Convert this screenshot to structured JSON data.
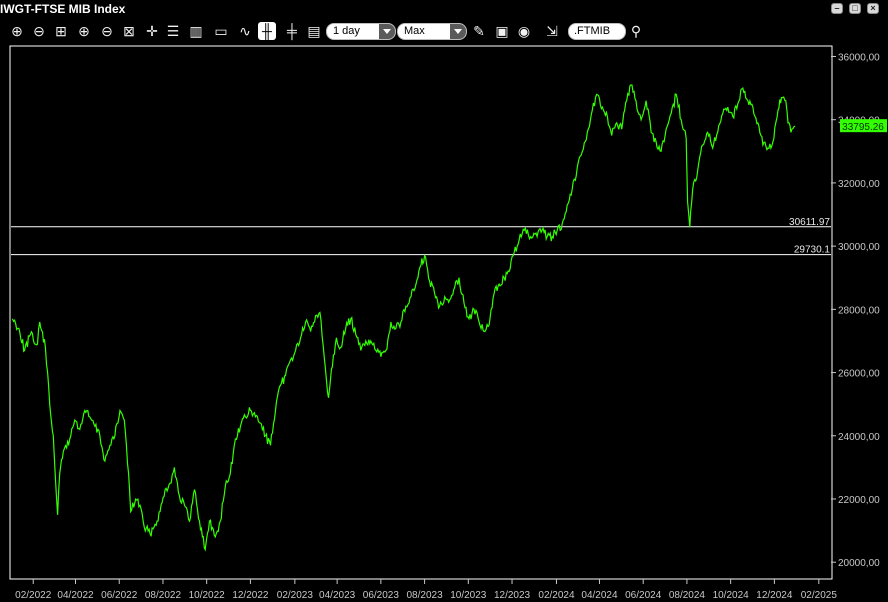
{
  "window": {
    "title": "IWGT-FTSE MIB Index"
  },
  "toolbar": {
    "interval_value": "1 day",
    "range_value": "Max",
    "symbol_value": ".FTMIB",
    "icons": [
      "zoom-in-icon",
      "zoom-out-icon",
      "zoom-fit-icon",
      "zoom-x-in-icon",
      "zoom-x-out-icon",
      "zoom-reset-icon",
      "crosshair-icon",
      "list-icon",
      "bars-icon",
      "box-icon",
      "line-chart-icon",
      "candlestick-icon",
      "ohlc-icon",
      "table-icon",
      "drawing-icon",
      "save-icon",
      "refresh-icon",
      "export-icon",
      "search-icon"
    ]
  },
  "colors": {
    "background": "#000000",
    "price_line": "#33ff00",
    "axis_text": "#c8c8c8",
    "horizontal_line": "#ffffff"
  },
  "chart_data": {
    "type": "line",
    "title": "IWGT-FTSE MIB Index",
    "grid": false,
    "ylim": [
      19500,
      36300
    ],
    "y_ticks": [
      "20000,00",
      "22000,00",
      "24000,00",
      "26000,00",
      "28000,00",
      "30000,00",
      "32000,00",
      "34000,00",
      "36000,00"
    ],
    "x_ticks": [
      "02/2022",
      "04/2022",
      "06/2022",
      "08/2022",
      "10/2022",
      "12/2022",
      "02/2023",
      "04/2023",
      "06/2023",
      "08/2023",
      "10/2023",
      "12/2023",
      "02/2024",
      "04/2024",
      "06/2024",
      "08/2024",
      "10/2024",
      "12/2024",
      "02/2025"
    ],
    "series": [
      {
        "points": [
          [
            "2022-01-03",
            27700
          ],
          [
            "2022-01-12",
            27400
          ],
          [
            "2022-01-20",
            26700
          ],
          [
            "2022-01-28",
            27200
          ],
          [
            "2022-02-07",
            26900
          ],
          [
            "2022-02-10",
            27600
          ],
          [
            "2022-02-18",
            26800
          ],
          [
            "2022-02-24",
            25000
          ],
          [
            "2022-03-01",
            24000
          ],
          [
            "2022-03-07",
            21500
          ],
          [
            "2022-03-10",
            22800
          ],
          [
            "2022-03-15",
            23500
          ],
          [
            "2022-03-24",
            23900
          ],
          [
            "2022-03-31",
            24500
          ],
          [
            "2022-04-07",
            24200
          ],
          [
            "2022-04-14",
            24800
          ],
          [
            "2022-04-21",
            24600
          ],
          [
            "2022-04-28",
            24300
          ],
          [
            "2022-05-05",
            24000
          ],
          [
            "2022-05-12",
            23200
          ],
          [
            "2022-05-19",
            23700
          ],
          [
            "2022-05-26",
            24000
          ],
          [
            "2022-06-02",
            24800
          ],
          [
            "2022-06-08",
            24500
          ],
          [
            "2022-06-14",
            22800
          ],
          [
            "2022-06-17",
            21600
          ],
          [
            "2022-06-24",
            22000
          ],
          [
            "2022-06-30",
            21800
          ],
          [
            "2022-07-06",
            21100
          ],
          [
            "2022-07-14",
            20900
          ],
          [
            "2022-07-21",
            21200
          ],
          [
            "2022-07-28",
            21600
          ],
          [
            "2022-08-04",
            22300
          ],
          [
            "2022-08-11",
            22500
          ],
          [
            "2022-08-17",
            23000
          ],
          [
            "2022-08-24",
            22100
          ],
          [
            "2022-08-31",
            21800
          ],
          [
            "2022-09-07",
            21300
          ],
          [
            "2022-09-14",
            22300
          ],
          [
            "2022-09-21",
            21300
          ],
          [
            "2022-09-29",
            20400
          ],
          [
            "2022-10-05",
            21300
          ],
          [
            "2022-10-13",
            20800
          ],
          [
            "2022-10-20",
            21300
          ],
          [
            "2022-10-27",
            22400
          ],
          [
            "2022-11-03",
            22800
          ],
          [
            "2022-11-10",
            23900
          ],
          [
            "2022-11-17",
            24300
          ],
          [
            "2022-11-24",
            24600
          ],
          [
            "2022-12-01",
            24800
          ],
          [
            "2022-12-08",
            24600
          ],
          [
            "2022-12-15",
            24400
          ],
          [
            "2022-12-22",
            24000
          ],
          [
            "2022-12-29",
            23700
          ],
          [
            "2023-01-05",
            24800
          ],
          [
            "2023-01-12",
            25600
          ],
          [
            "2023-01-19",
            25900
          ],
          [
            "2023-01-26",
            26400
          ],
          [
            "2023-02-02",
            26700
          ],
          [
            "2023-02-09",
            27100
          ],
          [
            "2023-02-16",
            27600
          ],
          [
            "2023-02-23",
            27300
          ],
          [
            "2023-03-02",
            27800
          ],
          [
            "2023-03-08",
            27900
          ],
          [
            "2023-03-14",
            26500
          ],
          [
            "2023-03-20",
            25200
          ],
          [
            "2023-03-24",
            26100
          ],
          [
            "2023-03-31",
            27100
          ],
          [
            "2023-04-06",
            26800
          ],
          [
            "2023-04-13",
            27400
          ],
          [
            "2023-04-20",
            27700
          ],
          [
            "2023-04-27",
            27200
          ],
          [
            "2023-05-04",
            26700
          ],
          [
            "2023-05-11",
            27000
          ],
          [
            "2023-05-18",
            27000
          ],
          [
            "2023-05-25",
            26700
          ],
          [
            "2023-06-01",
            26500
          ],
          [
            "2023-06-08",
            26700
          ],
          [
            "2023-06-15",
            27600
          ],
          [
            "2023-06-22",
            27400
          ],
          [
            "2023-06-29",
            27600
          ],
          [
            "2023-07-06",
            28100
          ],
          [
            "2023-07-13",
            28400
          ],
          [
            "2023-07-20",
            28800
          ],
          [
            "2023-07-27",
            29400
          ],
          [
            "2023-08-01",
            29700
          ],
          [
            "2023-08-08",
            28900
          ],
          [
            "2023-08-15",
            28500
          ],
          [
            "2023-08-22",
            28100
          ],
          [
            "2023-08-29",
            28400
          ],
          [
            "2023-09-05",
            28300
          ],
          [
            "2023-09-12",
            28700
          ],
          [
            "2023-09-18",
            29000
          ],
          [
            "2023-09-25",
            28200
          ],
          [
            "2023-10-02",
            27700
          ],
          [
            "2023-10-09",
            28000
          ],
          [
            "2023-10-16",
            27600
          ],
          [
            "2023-10-23",
            27300
          ],
          [
            "2023-10-30",
            27500
          ],
          [
            "2023-11-06",
            28500
          ],
          [
            "2023-11-13",
            28800
          ],
          [
            "2023-11-20",
            29000
          ],
          [
            "2023-11-27",
            29200
          ],
          [
            "2023-12-04",
            29800
          ],
          [
            "2023-12-11",
            30200
          ],
          [
            "2023-12-18",
            30500
          ],
          [
            "2023-12-27",
            30300
          ],
          [
            "2024-01-05",
            30300
          ],
          [
            "2024-01-12",
            30500
          ],
          [
            "2024-01-19",
            30300
          ],
          [
            "2024-01-26",
            30300
          ],
          [
            "2024-02-02",
            30500
          ],
          [
            "2024-02-09",
            30700
          ],
          [
            "2024-02-16",
            31300
          ],
          [
            "2024-02-23",
            31800
          ],
          [
            "2024-03-01",
            32500
          ],
          [
            "2024-03-08",
            33000
          ],
          [
            "2024-03-15",
            33600
          ],
          [
            "2024-03-22",
            34300
          ],
          [
            "2024-03-28",
            34800
          ],
          [
            "2024-04-05",
            34400
          ],
          [
            "2024-04-12",
            34100
          ],
          [
            "2024-04-18",
            33500
          ],
          [
            "2024-04-25",
            33900
          ],
          [
            "2024-05-02",
            33700
          ],
          [
            "2024-05-09",
            34600
          ],
          [
            "2024-05-15",
            35100
          ],
          [
            "2024-05-22",
            34600
          ],
          [
            "2024-05-29",
            34000
          ],
          [
            "2024-06-05",
            34600
          ],
          [
            "2024-06-12",
            33600
          ],
          [
            "2024-06-19",
            33300
          ],
          [
            "2024-06-26",
            33000
          ],
          [
            "2024-07-03",
            33700
          ],
          [
            "2024-07-10",
            34200
          ],
          [
            "2024-07-17",
            34800
          ],
          [
            "2024-07-24",
            34000
          ],
          [
            "2024-07-31",
            33400
          ],
          [
            "2024-08-02",
            31400
          ],
          [
            "2024-08-05",
            30600
          ],
          [
            "2024-08-09",
            31800
          ],
          [
            "2024-08-16",
            32400
          ],
          [
            "2024-08-23",
            33200
          ],
          [
            "2024-08-30",
            33600
          ],
          [
            "2024-09-06",
            33100
          ],
          [
            "2024-09-13",
            33600
          ],
          [
            "2024-09-20",
            34200
          ],
          [
            "2024-09-27",
            34400
          ],
          [
            "2024-10-04",
            34100
          ],
          [
            "2024-10-11",
            34500
          ],
          [
            "2024-10-18",
            35000
          ],
          [
            "2024-10-25",
            34600
          ],
          [
            "2024-11-01",
            34400
          ],
          [
            "2024-11-08",
            33900
          ],
          [
            "2024-11-15",
            33200
          ],
          [
            "2024-11-22",
            33100
          ],
          [
            "2024-11-29",
            33300
          ],
          [
            "2024-12-06",
            34300
          ],
          [
            "2024-12-11",
            34700
          ],
          [
            "2024-12-17",
            34600
          ],
          [
            "2024-12-20",
            33900
          ],
          [
            "2024-12-24",
            33600
          ],
          [
            "2024-12-30",
            33795
          ]
        ]
      }
    ],
    "horizontal_lines": [
      {
        "value": 30611.97,
        "label": "30611.97"
      },
      {
        "value": 29730.1,
        "label": "29730.1"
      }
    ],
    "last_value": {
      "value": 33795.26,
      "label": "33795.26"
    }
  }
}
